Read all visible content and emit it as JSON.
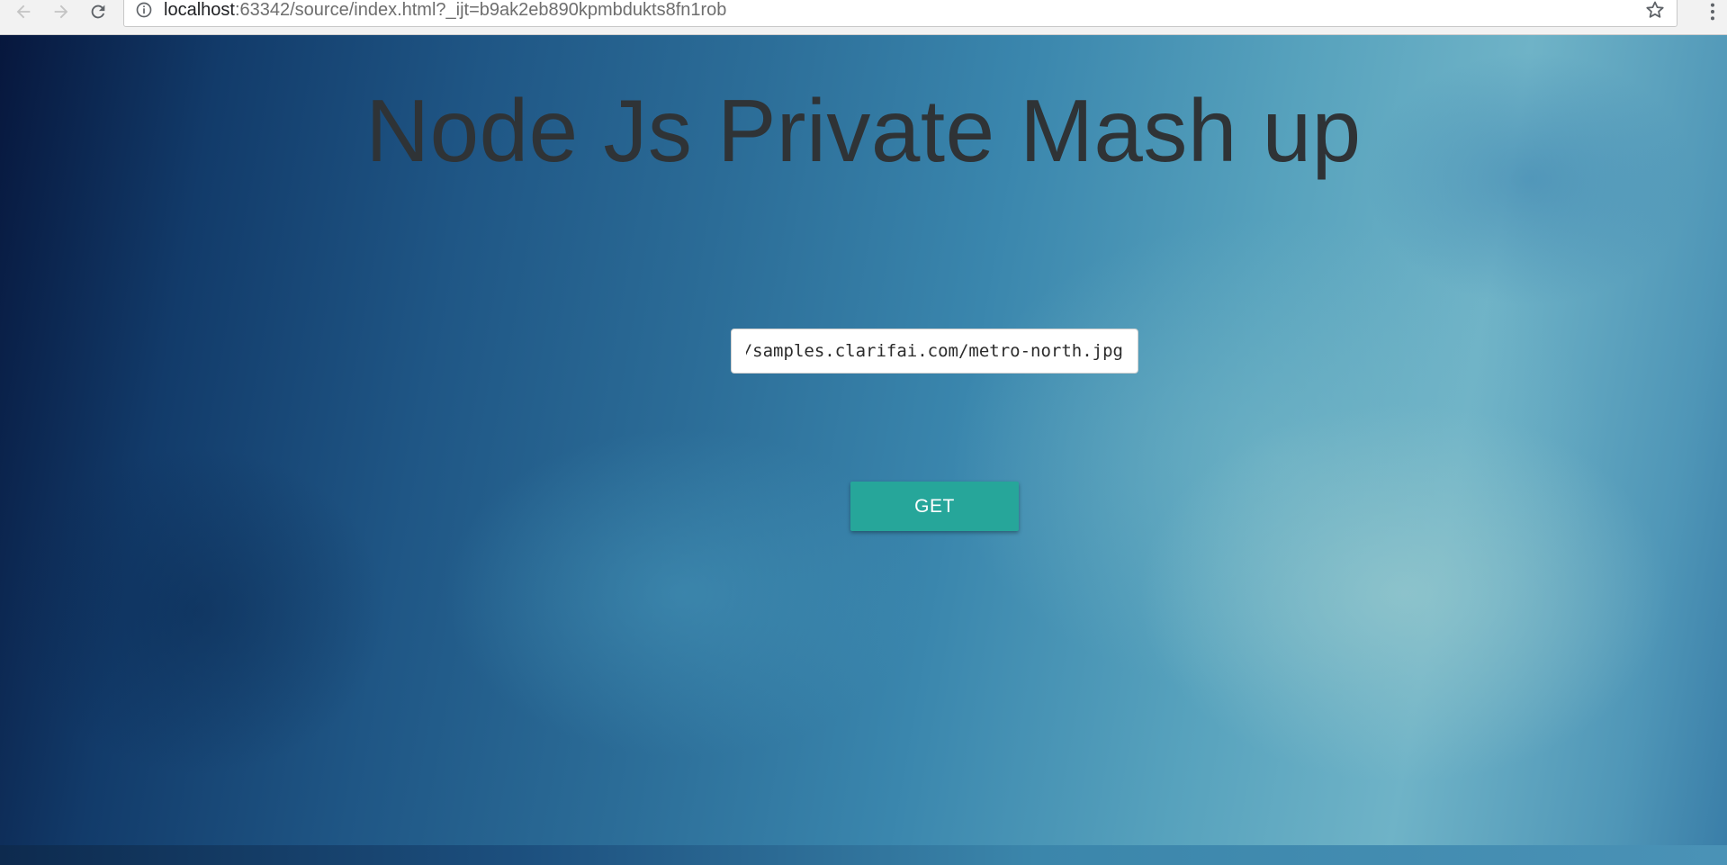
{
  "browser": {
    "url_host": "localhost",
    "url_rest": ":63342/source/index.html?_ijt=b9ak2eb890kpmbdukts8fn1rob",
    "icons": {
      "back": "arrow-left-icon",
      "forward": "arrow-right-icon",
      "reload": "reload-icon",
      "info": "info-icon",
      "bookmark": "star-icon",
      "menu": "kebab-menu-icon"
    }
  },
  "page": {
    "title": "Node Js Private Mash up",
    "url_input_value": "https://samples.clarifai.com/metro-north.jpg",
    "get_button_label": "GET"
  },
  "colors": {
    "button_accent": "#26a69a",
    "title_text": "#2f3336"
  }
}
